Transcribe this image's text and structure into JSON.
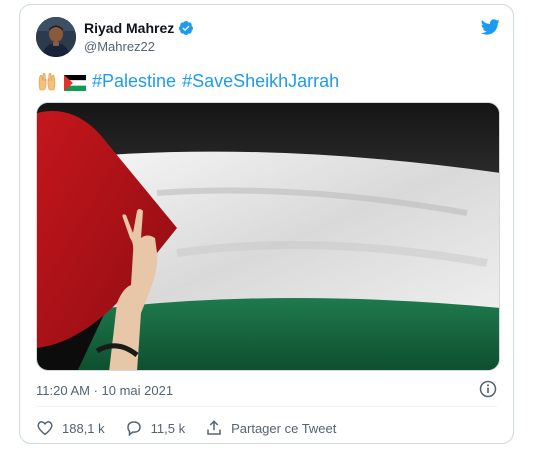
{
  "tweet": {
    "author_name": "Riyad Mahrez",
    "author_handle": "@Mahrez22",
    "hashtags": [
      "#Palestine",
      "#SaveSheikhJarrah"
    ],
    "timestamp": "11:20 AM · 10 mai 2021",
    "likes": "188,1 k",
    "replies": "11,5 k",
    "share_label": "Partager ce Tweet"
  },
  "icons": {
    "verified": "verified-badge-icon",
    "brand": "twitter-bird-icon",
    "emoji_1": "raising-hands-emoji",
    "emoji_2": "palestine-flag-emoji",
    "info": "info-icon",
    "like": "heart-icon",
    "reply": "speech-bubble-icon",
    "share": "share-icon"
  },
  "colors": {
    "accent": "#1d9bf0",
    "text": "#0f1419",
    "secondary": "#536471",
    "border": "#cfd9de"
  }
}
